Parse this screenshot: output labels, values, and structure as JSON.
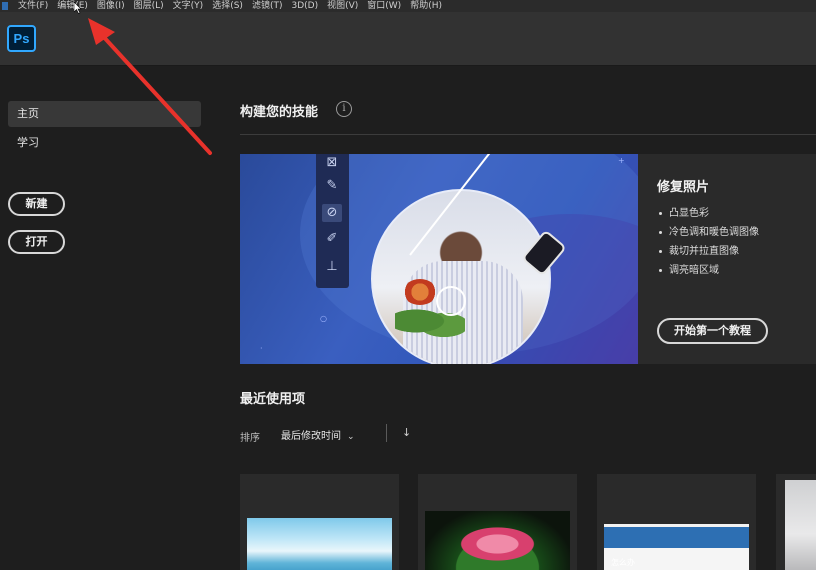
{
  "menubar": {
    "items": [
      "文件(F)",
      "编辑(E)",
      "图像(I)",
      "图层(L)",
      "文字(Y)",
      "选择(S)",
      "滤镜(T)",
      "3D(D)",
      "视图(V)",
      "窗口(W)",
      "帮助(H)"
    ]
  },
  "header": {
    "logo": "Ps"
  },
  "sidebar": {
    "nav": [
      {
        "label": "主页",
        "active": true
      },
      {
        "label": "学习",
        "active": false
      }
    ],
    "buttons": {
      "new": "新建",
      "open": "打开"
    }
  },
  "main": {
    "skills_title": "构建您的技能",
    "info_icon": "i",
    "tutorial": {
      "title": "修复照片",
      "items": [
        "凸显色彩",
        "冷色调和暖色调图像",
        "裁切并拉直图像",
        "调亮暗区域"
      ],
      "start_button": "开始第一个教程"
    },
    "recent": {
      "title": "最近使用项",
      "sort_label": "排序",
      "sort_value": "最后修改时间",
      "files": [
        {
          "thumb": "sky-landscape"
        },
        {
          "thumb": "lotus-flower"
        },
        {
          "thumb": "screen-photo",
          "text": "怎么办"
        },
        {
          "thumb": "partial"
        }
      ]
    }
  },
  "icons": {
    "tools": [
      "frame-icon",
      "eyedropper-icon",
      "bandage-icon",
      "brush-icon",
      "stamp-icon"
    ]
  },
  "colors": {
    "accent": "#31a8ff",
    "annotation": "#e8322b",
    "background": "#1e1e1e"
  }
}
